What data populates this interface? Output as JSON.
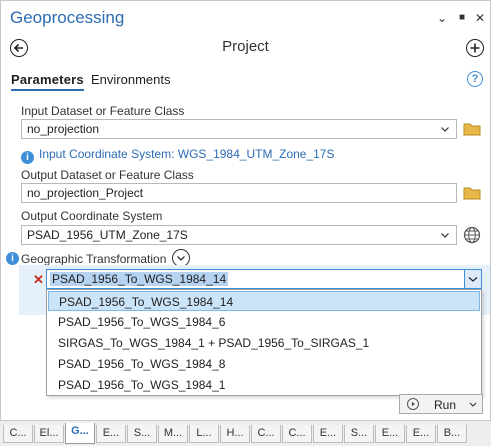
{
  "pane": {
    "title": "Geoprocessing",
    "controls": [
      "⌄",
      "■",
      "✕"
    ]
  },
  "tool": {
    "title": "Project"
  },
  "tabs": [
    "Parameters",
    "Environments"
  ],
  "help": "?",
  "params": {
    "input_label": "Input Dataset or Feature Class",
    "input_value": "no_projection",
    "input_cs_info": "Input Coordinate System: WGS_1984_UTM_Zone_17S",
    "output_label": "Output Dataset or Feature Class",
    "output_value": "no_projection_Project",
    "out_cs_label": "Output Coordinate System",
    "out_cs_value": "PSAD_1956_UTM_Zone_17S",
    "gt_label": "Geographic Transformation",
    "gt_value": "PSAD_1956_To_WGS_1984_14"
  },
  "gt_options": [
    "PSAD_1956_To_WGS_1984_14",
    "PSAD_1956_To_WGS_1984_6",
    "SIRGAS_To_WGS_1984_1 + PSAD_1956_To_SIRGAS_1",
    "PSAD_1956_To_WGS_1984_8",
    "PSAD_1956_To_WGS_1984_1"
  ],
  "gt_selected_index": 0,
  "run": {
    "label": "Run"
  },
  "bottom_tabs": [
    "C...",
    "El...",
    "G...",
    "E...",
    "S...",
    "M...",
    "L...",
    "H...",
    "C...",
    "C...",
    "E...",
    "S...",
    "E...",
    "E...",
    "B..."
  ],
  "bottom_active_index": 2,
  "colors": {
    "accent": "#2b6cb3",
    "info": "#3e8fd8",
    "remove": "#c42b1c",
    "selection": "#cce4f7"
  },
  "icons": {
    "back": "back-arrow-icon",
    "add": "plus-icon",
    "folder": "folder-icon",
    "globe": "globe-icon",
    "info": "info-icon",
    "expand": "chevron-down-icon",
    "run": "play-icon"
  }
}
